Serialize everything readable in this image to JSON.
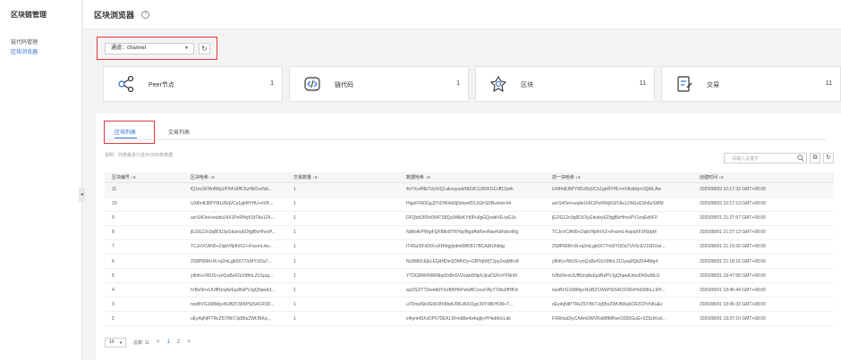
{
  "sidebar": {
    "title": "区块链管理",
    "items": [
      {
        "label": "链代码管理"
      },
      {
        "label": "区块浏览器"
      }
    ]
  },
  "header": {
    "title": "区块浏览器"
  },
  "channel": {
    "label": "通道：channel"
  },
  "stats": [
    {
      "label": "Peer节点",
      "value": "1",
      "icon": "peer-nodes-icon"
    },
    {
      "label": "链代码",
      "value": "1",
      "icon": "chaincode-icon"
    },
    {
      "label": "区块",
      "value": "11",
      "icon": "block-icon"
    },
    {
      "label": "交易",
      "value": "11",
      "icon": "transaction-icon"
    }
  ],
  "tabs": [
    {
      "label": "区块列表"
    },
    {
      "label": "交易列表"
    }
  ],
  "note": "说明：列表最多只显示2000条数据",
  "search": {
    "placeholder": "请输入关键字"
  },
  "table": {
    "columns": [
      "区块编号 ↓≡",
      "区块哈希 ↓≡",
      "交易数量 ↓≡",
      "数据哈希 ↓≡",
      "前一块哈希 ↓≡",
      "创建时间 ↓≡"
    ],
    "rows": [
      [
        "11",
        "lQ1ncSFRnfWg1/FNFUiffCKzHE0vcNd...",
        "1",
        "4vYXu4Nb7UyVrQLakvuyudxNtZdCU36/KGCvff12yek",
        "UXifm8J8PYl81dSqVCs1gbRYHU+nVKdxkj+UQA/LAw",
        "2020/08/02 10:17:32 GMT+08:00"
      ],
      [
        "10",
        "UXifm8J8PYl81dSqVCs1gbRYHU+nVK...",
        "1",
        "HigoFFb0GgJjThDHl4a6Ij0zkzefD1XGhSDBvxkd+h4",
        "axrS4Oet+wubkU4X1PoRNrjKStTAs1Z4tGcESh6uSWM",
        "2020/08/02 10:17:13 GMT+08:00"
      ],
      [
        "9",
        "axrS4Oet+wubkU4X1PoRNrjKStTAs1Z4...",
        "1",
        "DFQtdr2fl3lv054TS8QuWAbKYt0Pu9gGQodeVE+pGJs",
        "jEZiG12n3q8DU3yGbuleyEDfgjf8vHhvxPV1oqEdhF0",
        "2020/08/01 21:27:57 GMT+08:00"
      ],
      [
        "8",
        "jEZiG12n3q8DU3yGbuleyEDfgjf8vHhvxP...",
        "1",
        "NjMoArPWgiFQF88n8TWYqvfltgdAW6evNaeKdFdeoWg",
        "TCJoVCAN5+ZiqkVflpIh/XZ+rFsomL4wpqXF3fXjtqM",
        "2020/08/01 21:27:13 GMT+08:00"
      ],
      [
        "7",
        "TCJoVCAN5+ZiqkVflpIh/XZ+rFsomL4w...",
        "1",
        "IT4SuI5FdDlX+jXH6tgjtydm6MKB17BCAjNUhibtg",
        "2S8P66M+/K+q2mLgb0X77/cMYUDa7UV6cEV16DUa/...",
        "2020/08/01 21:19:20 GMT+08:00"
      ],
      [
        "6",
        "2S8P66M+/K+q2mLgb0X77/cMYUDa7...",
        "1",
        "Nc8MI0cEjkLEQdHDeQDMhDy+ORYqIWjT2pp2xqMKo8",
        "y9hKi+/WUS+yoQuBz42zX9ftnLZU1paj0QkZ644Mg4",
        "2020/08/01 21:18:16 GMT+08:00"
      ],
      [
        "5",
        "y9hKi+/WUS+yoQuBz42zX9ftnLZU1paj...",
        "1",
        "YTDG8WrlNWiNbpDxBn9V2owkDNp/UjnxDlJFoYFNnI0",
        "iVBvNl+vUUfffUrqAzEpzBxPVJgQhpeAJmuDh6w9tLU",
        "2020/08/01 18:47:58 GMT+08:00"
      ],
      [
        "4",
        "iVBvNl+vUUfffUrqAzEpzBxPVJgQhpeA3...",
        "1",
        "sjs2S2/TTDwe8dYXoBNHtrPeiwBCceuOAyT1Wu2fHfOs",
        "nxeBVG168Mg+NUBZCWbPStS4CR3DnHrd36fnLLMY...",
        "2020/08/01 18:46:44 GMT+08:00"
      ],
      [
        "3",
        "nxeBVG168Mg+NUBZCWbPStS4CR3D...",
        "1",
        "uTDnwlSkVEtlX3fX8bdU09UAX01gc39YWKHOR+T...",
        "oEy4qNtPTRvZ57/Wi7Jq5BsZWfJNKq6CRZCPcNKuEc",
        "2020/08/01 18:45:33 GMT+08:00"
      ],
      [
        "2",
        "oEy4qNtPTRvZ57/Wi7Jq5BsZWfJNKq...",
        "1",
        "s4tym4SFzDP57DEKL5FmkBe4u4ugtj+fY4ebK/cLdk",
        "FXRmal3/yCAAm0WVRsMflMRseO265GuG+3Z5ztXvd...",
        "2020/08/01 18:37:10 GMT+08:00"
      ]
    ]
  },
  "pager": {
    "page_size": "10",
    "total": "总数: 11",
    "pages": [
      "1",
      "2"
    ],
    "prev": "<",
    "next": ">"
  }
}
